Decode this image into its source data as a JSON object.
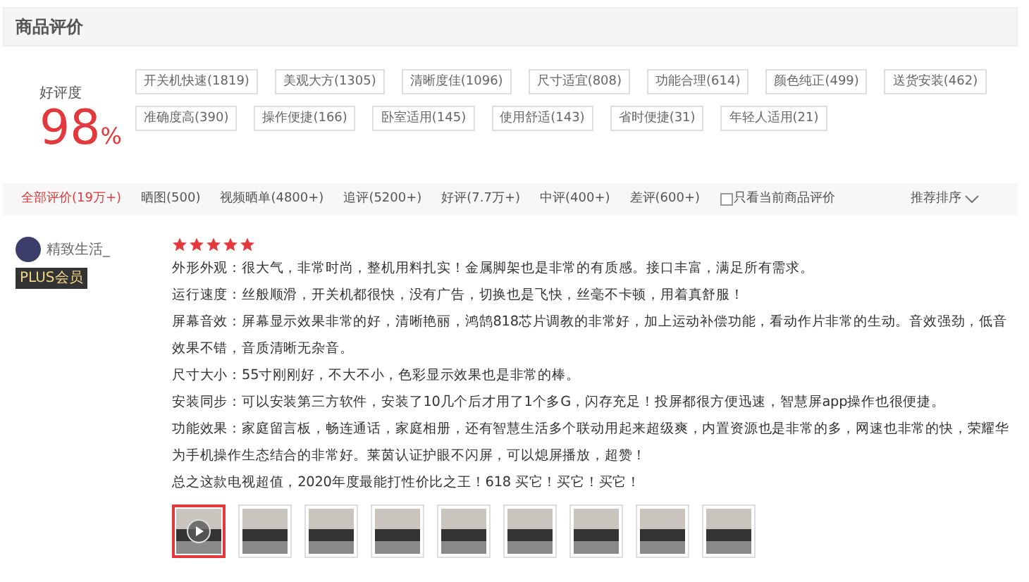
{
  "header": {
    "title": "商品评价"
  },
  "summary": {
    "label": "好评度",
    "value": "98",
    "unit": "%"
  },
  "tags": [
    "开关机快速(1819)",
    "美观大方(1305)",
    "清晰度佳(1096)",
    "尺寸适宜(808)",
    "功能合理(614)",
    "颜色纯正(499)",
    "送货安装(462)",
    "准确度高(390)",
    "操作便捷(166)",
    "卧室适用(145)",
    "使用舒适(143)",
    "省时便捷(31)",
    "年轻人适用(21)"
  ],
  "filters": [
    {
      "label": "全部评价(19万+)",
      "selected": true
    },
    {
      "label": "晒图(500)",
      "selected": false
    },
    {
      "label": "视频晒单(4800+)",
      "selected": false
    },
    {
      "label": "追评(5200+)",
      "selected": false
    },
    {
      "label": "好评(7.7万+)",
      "selected": false
    },
    {
      "label": "中评(400+)",
      "selected": false
    },
    {
      "label": "差评(600+)",
      "selected": false
    }
  ],
  "current_only": {
    "label": "只看当前商品评价",
    "checked": false
  },
  "sort": {
    "label": "推荐排序"
  },
  "review": {
    "user": "精致生活_",
    "badge": "PLUS会员",
    "stars": 5,
    "paragraphs": [
      "外形外观：很大气，非常时尚，整机用料扎实！金属脚架也是非常的有质感。接口丰富，满足所有需求。",
      "运行速度：丝般顺滑，开关机都很快，没有广告，切换也是飞快，丝毫不卡顿，用着真舒服！",
      "屏幕音效：屏幕显示效果非常的好，清晰艳丽，鸿鹄818芯片调教的非常好，加上运动补偿功能，看动作片非常的生动。音效强劲，低音效果不错，音质清晰无杂音。",
      "尺寸大小：55寸刚刚好，不大不小，色彩显示效果也是非常的棒。",
      "安装同步：可以安装第三方软件，安装了10几个后才用了1个多G，闪存充足！投屏都很方便迅速，智慧屏app操作也很便捷。",
      "功能效果：家庭留言板，畅连通话，家庭相册，还有智慧生活多个联动用起来超级爽，内置资源也是非常的多，网速也非常的快，荣耀华为手机操作生态结合的非常好。莱茵认证护眼不闪屏，可以熄屏播放，超赞！",
      "总之这款电视超值，2020年度最能打性价比之王！618 买它！买它！买它！"
    ],
    "thumbnails": [
      {
        "kind": "video",
        "selected": true
      },
      {
        "kind": "photo",
        "selected": false
      },
      {
        "kind": "photo",
        "selected": false
      },
      {
        "kind": "photo",
        "selected": false
      },
      {
        "kind": "photo",
        "selected": false
      },
      {
        "kind": "photo",
        "selected": false
      },
      {
        "kind": "photo",
        "selected": false
      },
      {
        "kind": "photo",
        "selected": false
      },
      {
        "kind": "photo",
        "selected": false
      }
    ]
  }
}
